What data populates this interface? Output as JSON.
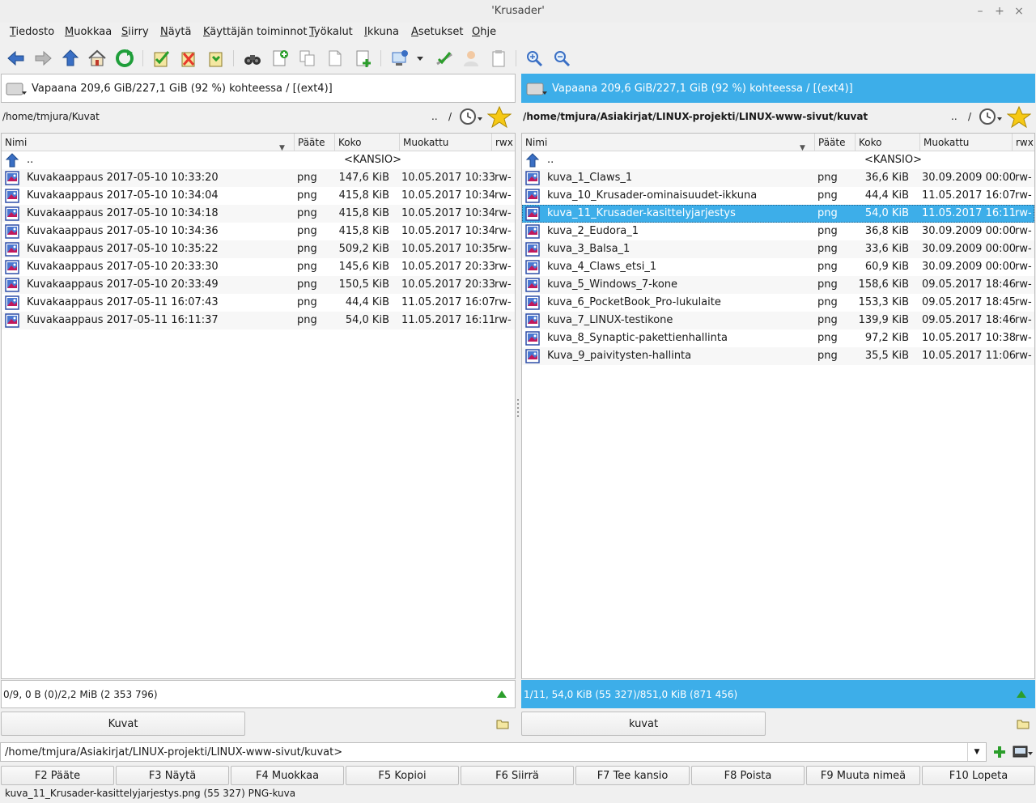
{
  "window": {
    "title": "'Krusader'"
  },
  "menu": [
    "Tiedosto",
    "Muokkaa",
    "Siirry",
    "Näytä",
    "Käyttäjän toiminnot",
    "Työkalut",
    "Ikkuna",
    "Asetukset",
    "Ohje"
  ],
  "colors": {
    "accent": "#3daee9",
    "green": "#2b9e2b",
    "red": "#e8392b"
  },
  "left": {
    "df": "Vapaana 209,6 GiB/227,1 GiB (92 %) kohteessa / [(ext4)]",
    "path": "/home/tmjura/Kuvat",
    "up_btn": "..",
    "root_btn": "/",
    "columns": [
      "Nimi",
      "Pääte",
      "Koko",
      "Muokattu",
      "rwx"
    ],
    "parent": {
      "name": "..",
      "size": "<KANSIO>"
    },
    "rows": [
      {
        "name": "Kuvakaappaus 2017-05-10 10:33:20",
        "ext": "png",
        "size": "147,6 KiB",
        "date": "10.05.2017 10:33",
        "perm": "rw-"
      },
      {
        "name": "Kuvakaappaus 2017-05-10 10:34:04",
        "ext": "png",
        "size": "415,8 KiB",
        "date": "10.05.2017 10:34",
        "perm": "rw-"
      },
      {
        "name": "Kuvakaappaus 2017-05-10 10:34:18",
        "ext": "png",
        "size": "415,8 KiB",
        "date": "10.05.2017 10:34",
        "perm": "rw-"
      },
      {
        "name": "Kuvakaappaus 2017-05-10 10:34:36",
        "ext": "png",
        "size": "415,8 KiB",
        "date": "10.05.2017 10:34",
        "perm": "rw-"
      },
      {
        "name": "Kuvakaappaus 2017-05-10 10:35:22",
        "ext": "png",
        "size": "509,2 KiB",
        "date": "10.05.2017 10:35",
        "perm": "rw-"
      },
      {
        "name": "Kuvakaappaus 2017-05-10 20:33:30",
        "ext": "png",
        "size": "145,6 KiB",
        "date": "10.05.2017 20:33",
        "perm": "rw-"
      },
      {
        "name": "Kuvakaappaus 2017-05-10 20:33:49",
        "ext": "png",
        "size": "150,5 KiB",
        "date": "10.05.2017 20:33",
        "perm": "rw-"
      },
      {
        "name": "Kuvakaappaus 2017-05-11 16:07:43",
        "ext": "png",
        "size": "44,4 KiB",
        "date": "11.05.2017 16:07",
        "perm": "rw-"
      },
      {
        "name": "Kuvakaappaus 2017-05-11 16:11:37",
        "ext": "png",
        "size": "54,0 KiB",
        "date": "11.05.2017 16:11",
        "perm": "rw-"
      }
    ],
    "status": "0/9, 0 B (0)/2,2 MiB (2 353 796)",
    "tab": "Kuvat"
  },
  "right": {
    "df": "Vapaana 209,6 GiB/227,1 GiB (92 %) kohteessa / [(ext4)]",
    "path": "/home/tmjura/Asiakirjat/LINUX-projekti/LINUX-www-sivut/kuvat",
    "up_btn": "..",
    "root_btn": "/",
    "columns": [
      "Nimi",
      "Pääte",
      "Koko",
      "Muokattu",
      "rwx"
    ],
    "parent": {
      "name": "..",
      "size": "<KANSIO>"
    },
    "rows": [
      {
        "name": "kuva_1_Claws_1",
        "ext": "png",
        "size": "36,6 KiB",
        "date": "30.09.2009 00:00",
        "perm": "rw-"
      },
      {
        "name": "kuva_10_Krusader-ominaisuudet-ikkuna",
        "ext": "png",
        "size": "44,4 KiB",
        "date": "11.05.2017 16:07",
        "perm": "rw-"
      },
      {
        "name": "kuva_11_Krusader-kasittelyjarjestys",
        "ext": "png",
        "size": "54,0 KiB",
        "date": "11.05.2017 16:11",
        "perm": "rw-",
        "selected": true
      },
      {
        "name": "kuva_2_Eudora_1",
        "ext": "png",
        "size": "36,8 KiB",
        "date": "30.09.2009 00:00",
        "perm": "rw-"
      },
      {
        "name": "kuva_3_Balsa_1",
        "ext": "png",
        "size": "33,6 KiB",
        "date": "30.09.2009 00:00",
        "perm": "rw-"
      },
      {
        "name": "kuva_4_Claws_etsi_1",
        "ext": "png",
        "size": "60,9 KiB",
        "date": "30.09.2009 00:00",
        "perm": "rw-"
      },
      {
        "name": "kuva_5_Windows_7-kone",
        "ext": "png",
        "size": "158,6 KiB",
        "date": "09.05.2017 18:46",
        "perm": "rw-"
      },
      {
        "name": "kuva_6_PocketBook_Pro-lukulaite",
        "ext": "png",
        "size": "153,3 KiB",
        "date": "09.05.2017 18:45",
        "perm": "rw-"
      },
      {
        "name": "kuva_7_LINUX-testikone",
        "ext": "png",
        "size": "139,9 KiB",
        "date": "09.05.2017 18:46",
        "perm": "rw-"
      },
      {
        "name": "kuva_8_Synaptic-pakettienhallinta",
        "ext": "png",
        "size": "97,2 KiB",
        "date": "10.05.2017 10:38",
        "perm": "rw-"
      },
      {
        "name": "Kuva_9_paivitysten-hallinta",
        "ext": "png",
        "size": "35,5 KiB",
        "date": "10.05.2017 11:06",
        "perm": "rw-"
      }
    ],
    "status": "1/11, 54,0 KiB (55 327)/851,0 KiB (871 456)",
    "tab": "kuvat"
  },
  "cmdline": "/home/tmjura/Asiakirjat/LINUX-projekti/LINUX-www-sivut/kuvat>",
  "fkeys": [
    {
      "key": "F2",
      "label": "Pääte"
    },
    {
      "key": "F3",
      "label": "Näytä"
    },
    {
      "key": "F4",
      "label": "Muokkaa"
    },
    {
      "key": "F5",
      "label": "Kopioi"
    },
    {
      "key": "F6",
      "label": "Siirrä"
    },
    {
      "key": "F7",
      "label": "Tee kansio"
    },
    {
      "key": "F8",
      "label": "Poista"
    },
    {
      "key": "F9",
      "label": "Muuta nimeä"
    },
    {
      "key": "F10",
      "label": "Lopeta"
    }
  ],
  "bottom_status": "kuva_11_Krusader-kasittelyjarjestys.png (55 327)  PNG-kuva"
}
